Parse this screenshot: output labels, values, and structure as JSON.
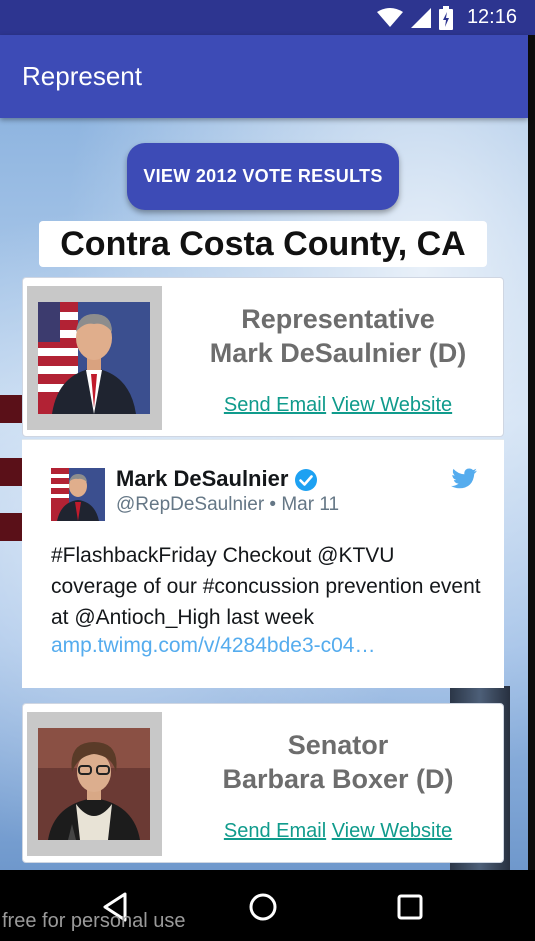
{
  "status_bar": {
    "time": "12:16"
  },
  "app_bar": {
    "title": "Represent"
  },
  "vote_button": {
    "label": "VIEW 2012 VOTE RESULTS"
  },
  "location": {
    "title": "Contra Costa County, CA"
  },
  "representatives": [
    {
      "title": "Representative",
      "name": "Mark DeSaulnier (D)",
      "email_link": "Send Email",
      "website_link": "View Website"
    },
    {
      "title": "Senator",
      "name": "Barbara Boxer (D)",
      "email_link": "Send Email",
      "website_link": "View Website"
    }
  ],
  "tweet": {
    "author_name": "Mark DeSaulnier",
    "handle_date": "@RepDeSaulnier • Mar 11",
    "text": "#FlashbackFriday Checkout @KTVU coverage of our #concussion prevention event at @Antioch_High last week",
    "link": "amp.twimg.com/v/4284bde3-c04…"
  },
  "watermark": "free for personal use",
  "colors": {
    "primary": "#3d4bb6",
    "primary_dark": "#2d3590",
    "link": "#109b8c",
    "twitter_blue": "#55acee"
  },
  "icons": [
    "wifi-icon",
    "signal-icon",
    "battery-icon",
    "verified-icon",
    "twitter-bird-icon",
    "back-icon",
    "home-icon",
    "recents-icon"
  ]
}
